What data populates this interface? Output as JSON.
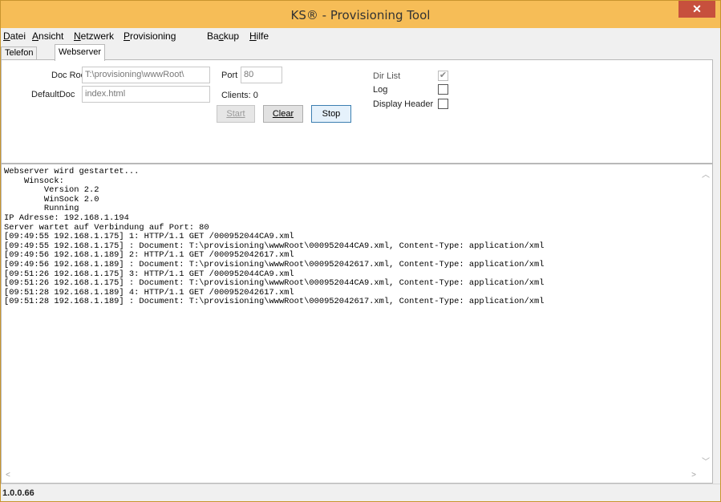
{
  "window": {
    "title": "KS® - Provisioning Tool",
    "close_glyph": "✕"
  },
  "menu": [
    {
      "accel": "D",
      "rest": "atei"
    },
    {
      "accel": "A",
      "rest": "nsicht"
    },
    {
      "accel": "N",
      "rest": "etzwerk"
    },
    {
      "accel": "P",
      "rest": "rovisioning"
    },
    {
      "pre": "Ba",
      "accel": "c",
      "rest": "kup"
    },
    {
      "accel": "H",
      "rest": "ilfe"
    }
  ],
  "tabs": [
    {
      "label": "Telefon"
    },
    {
      "label": "Webserver"
    }
  ],
  "webserver": {
    "docroot_label": "Doc Roo",
    "docroot_value": "T:\\provisioning\\wwwRoot\\",
    "defaultdoc_label": "DefaultDoc",
    "defaultdoc_value": "index.html",
    "port_label": "Port",
    "port_value": "80",
    "clients_label": "Clients: 0",
    "start_label": "Start",
    "clear_label": "Clear",
    "stop_label": "Stop",
    "dirlist_label": "Dir List",
    "dirlist_checked": true,
    "log_label": "Log",
    "log_checked": false,
    "display_header_label": "Display Header",
    "display_header_checked": false
  },
  "log": {
    "lines": [
      "Webserver wird gestartet...",
      "    Winsock:",
      "        Version 2.2",
      "        WinSock 2.0",
      "        Running",
      "IP Adresse: 192.168.1.194",
      "Server wartet auf Verbindung auf Port: 80",
      "[09:49:55 192.168.1.175] 1: HTTP/1.1 GET /000952044CA9.xml",
      "[09:49:55 192.168.1.175] : Document: T:\\provisioning\\wwwRoot\\000952044CA9.xml, Content-Type: application/xml",
      "[09:49:56 192.168.1.189] 2: HTTP/1.1 GET /000952042617.xml",
      "[09:49:56 192.168.1.189] : Document: T:\\provisioning\\wwwRoot\\000952042617.xml, Content-Type: application/xml",
      "[09:51:26 192.168.1.175] 3: HTTP/1.1 GET /000952044CA9.xml",
      "[09:51:26 192.168.1.175] : Document: T:\\provisioning\\wwwRoot\\000952044CA9.xml, Content-Type: application/xml",
      "[09:51:28 192.168.1.189] 4: HTTP/1.1 GET /000952042617.xml",
      "[09:51:28 192.168.1.189] : Document: T:\\provisioning\\wwwRoot\\000952042617.xml, Content-Type: application/xml"
    ]
  },
  "status": {
    "version": "1.0.0.66"
  },
  "icons": {
    "close": "close-icon",
    "scroll_up": "chevron-up-icon",
    "scroll_down": "chevron-down-icon",
    "scroll_left": "chevron-left-icon",
    "scroll_right": "chevron-right-icon",
    "check": "checkmark-icon"
  },
  "colors": {
    "titlebar": "#f6bd57",
    "close_button": "#c7503d",
    "focused_button": "#3c7fb1"
  }
}
